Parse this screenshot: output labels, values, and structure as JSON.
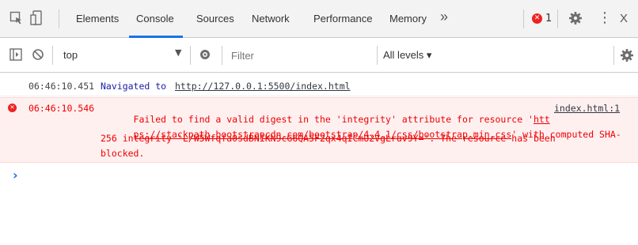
{
  "tabs": [
    {
      "label": "Elements"
    },
    {
      "label": "Console",
      "active": true
    },
    {
      "label": "Sources"
    },
    {
      "label": "Network"
    },
    {
      "label": "Performance"
    },
    {
      "label": "Memory"
    }
  ],
  "more_tabs": "»",
  "error_count": "1",
  "kebab": "⋮",
  "close": "X",
  "context": "top",
  "filter_placeholder": "Filter",
  "levels": "All levels ▾",
  "messages": {
    "nav": {
      "timestamp": "06:46:10.451",
      "prefix": "Navigated to",
      "url": "http://127.0.0.1:5500/index.html"
    },
    "error": {
      "timestamp": "06:46:10.546",
      "line1_a": "Failed to find a valid digest in the 'integrity' attribute for resource '",
      "line1_b": "htt",
      "source": "index.html:1",
      "line2_url": "ps://stackpath.bootstrapcdn.com/bootstrap/4.4.1/css/bootstrap.min.css",
      "line2_b": "' with computed SHA-",
      "line3": "256 integrity 'L/W5Wfqfa0sdBNIKN9cG6QA5F2qx4qICmU2VgLruv9Y='. The resource has been",
      "line4": "blocked."
    }
  },
  "prompt": "›",
  "colors": {
    "accent": "#1a73e8",
    "error_text": "#ee0000",
    "error_bg": "#fff0f0",
    "nav_text": "#1a1aa6"
  }
}
